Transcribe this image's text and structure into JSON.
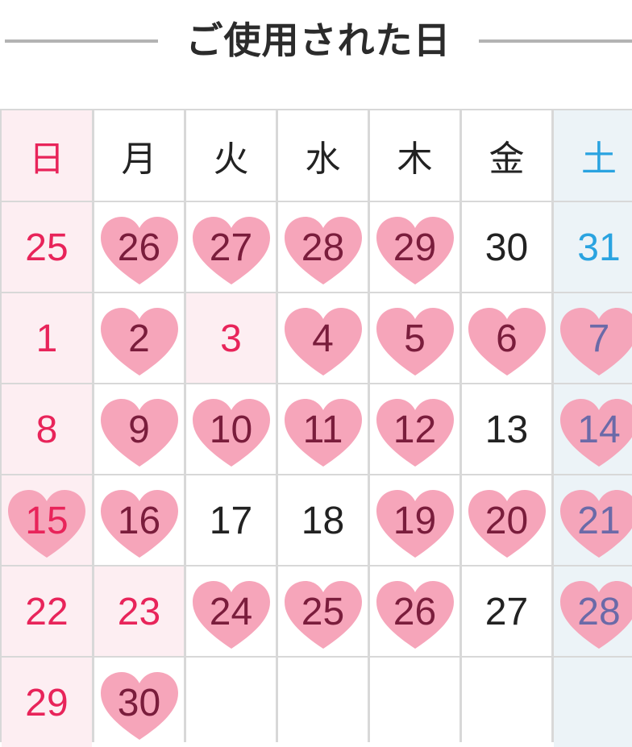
{
  "title": "ご使用された日",
  "colors": {
    "sunday": "#e8245a",
    "saturday": "#2aa3e0",
    "heart": "#f5a0b6",
    "line": "#b3b3b3"
  },
  "weekdays": [
    "日",
    "月",
    "火",
    "水",
    "木",
    "金",
    "土"
  ],
  "rows": [
    [
      {
        "day": "25",
        "heart": false,
        "holiday": false
      },
      {
        "day": "26",
        "heart": true,
        "holiday": false
      },
      {
        "day": "27",
        "heart": true,
        "holiday": false
      },
      {
        "day": "28",
        "heart": true,
        "holiday": false
      },
      {
        "day": "29",
        "heart": true,
        "holiday": false
      },
      {
        "day": "30",
        "heart": false,
        "holiday": false
      },
      {
        "day": "31",
        "heart": false,
        "holiday": false
      }
    ],
    [
      {
        "day": "1",
        "heart": false,
        "holiday": false
      },
      {
        "day": "2",
        "heart": true,
        "holiday": false
      },
      {
        "day": "3",
        "heart": false,
        "holiday": true
      },
      {
        "day": "4",
        "heart": true,
        "holiday": false
      },
      {
        "day": "5",
        "heart": true,
        "holiday": false
      },
      {
        "day": "6",
        "heart": true,
        "holiday": false
      },
      {
        "day": "7",
        "heart": true,
        "holiday": false
      }
    ],
    [
      {
        "day": "8",
        "heart": false,
        "holiday": false
      },
      {
        "day": "9",
        "heart": true,
        "holiday": false
      },
      {
        "day": "10",
        "heart": true,
        "holiday": false
      },
      {
        "day": "11",
        "heart": true,
        "holiday": false
      },
      {
        "day": "12",
        "heart": true,
        "holiday": false
      },
      {
        "day": "13",
        "heart": false,
        "holiday": false
      },
      {
        "day": "14",
        "heart": true,
        "holiday": false
      }
    ],
    [
      {
        "day": "15",
        "heart": true,
        "holiday": false
      },
      {
        "day": "16",
        "heart": true,
        "holiday": false
      },
      {
        "day": "17",
        "heart": false,
        "holiday": false
      },
      {
        "day": "18",
        "heart": false,
        "holiday": false
      },
      {
        "day": "19",
        "heart": true,
        "holiday": false
      },
      {
        "day": "20",
        "heart": true,
        "holiday": false
      },
      {
        "day": "21",
        "heart": true,
        "holiday": false
      }
    ],
    [
      {
        "day": "22",
        "heart": false,
        "holiday": false
      },
      {
        "day": "23",
        "heart": false,
        "holiday": true
      },
      {
        "day": "24",
        "heart": true,
        "holiday": false
      },
      {
        "day": "25",
        "heart": true,
        "holiday": false
      },
      {
        "day": "26",
        "heart": true,
        "holiday": false
      },
      {
        "day": "27",
        "heart": false,
        "holiday": false
      },
      {
        "day": "28",
        "heart": true,
        "holiday": false
      }
    ],
    [
      {
        "day": "29",
        "heart": false,
        "holiday": false
      },
      {
        "day": "30",
        "heart": true,
        "holiday": false
      },
      {
        "day": "",
        "heart": false,
        "holiday": false
      },
      {
        "day": "",
        "heart": false,
        "holiday": false
      },
      {
        "day": "",
        "heart": false,
        "holiday": false
      },
      {
        "day": "",
        "heart": false,
        "holiday": false
      },
      {
        "day": "",
        "heart": false,
        "holiday": false
      }
    ]
  ]
}
